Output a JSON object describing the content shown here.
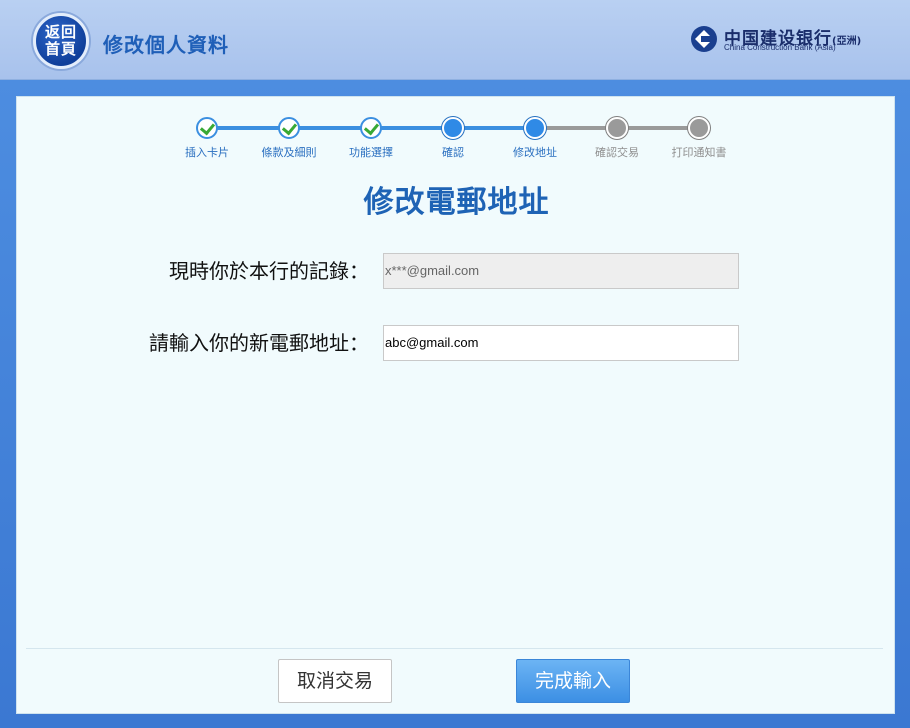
{
  "header": {
    "home_label_line1": "返回",
    "home_label_line2": "首頁",
    "title": "修改個人資料",
    "bank_name_cn": "中国建设银行",
    "bank_name_cn_suffix": "(亞洲)",
    "bank_name_en": "China Construction Bank (Asia)"
  },
  "steps": [
    {
      "label": "插入卡片",
      "status": "done"
    },
    {
      "label": "條款及細則",
      "status": "done"
    },
    {
      "label": "功能選擇",
      "status": "done"
    },
    {
      "label": "確認",
      "status": "active"
    },
    {
      "label": "修改地址",
      "status": "active"
    },
    {
      "label": "確認交易",
      "status": "pending"
    },
    {
      "label": "打印通知書",
      "status": "pending"
    }
  ],
  "page_title": "修改電郵地址",
  "form": {
    "current_label": "現時你於本行的記錄：",
    "current_value": "x***@gmail.com",
    "new_label": "請輸入你的新電郵地址：",
    "new_value": "abc@gmail.com"
  },
  "buttons": {
    "cancel": "取消交易",
    "confirm": "完成輸入"
  },
  "colors": {
    "accent": "#1e63b5",
    "step_done_check": "#39a935",
    "step_active": "#2f8ae6",
    "step_pending": "#9a9a9a"
  }
}
